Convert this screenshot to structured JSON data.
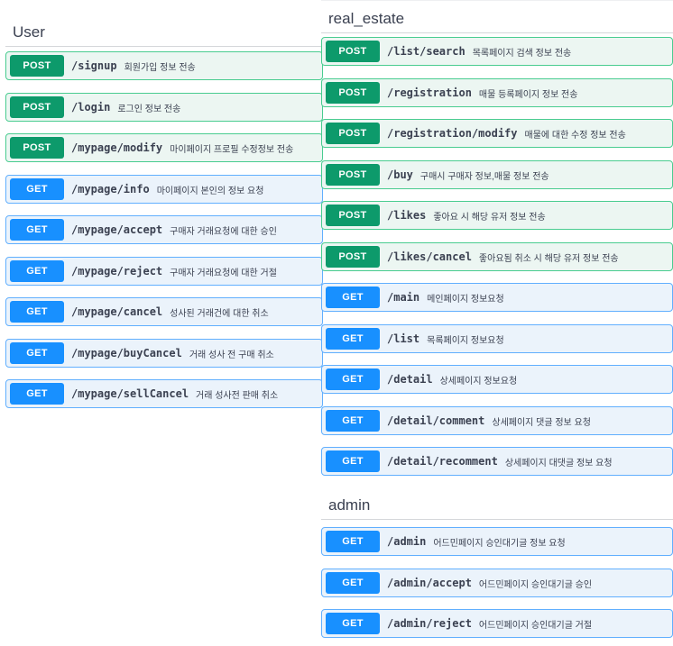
{
  "sections": {
    "user": {
      "title": "User",
      "ops": [
        {
          "method": "POST",
          "path": "/signup",
          "desc": "회원가입 정보 전송"
        },
        {
          "method": "POST",
          "path": "/login",
          "desc": "로그인 정보 전송"
        },
        {
          "method": "POST",
          "path": "/mypage/modify",
          "desc": "마이페이지 프로필 수정정보 전송"
        },
        {
          "method": "GET",
          "path": "/mypage/info",
          "desc": "마이페이지 본인의 정보 요청"
        },
        {
          "method": "GET",
          "path": "/mypage/accept",
          "desc": "구매자 거래요청에 대한 승인"
        },
        {
          "method": "GET",
          "path": "/mypage/reject",
          "desc": "구매자 거래요청에 대한 거절"
        },
        {
          "method": "GET",
          "path": "/mypage/cancel",
          "desc": "성사된 거래건에 대한 취소"
        },
        {
          "method": "GET",
          "path": "/mypage/buyCancel",
          "desc": "거래 성사 전 구매 취소"
        },
        {
          "method": "GET",
          "path": "/mypage/sellCancel",
          "desc": "거래 성사전 판매 취소"
        }
      ]
    },
    "real_estate": {
      "title": "real_estate",
      "ops": [
        {
          "method": "POST",
          "path": "/list/search",
          "desc": "목록페이지 검색 정보 전송"
        },
        {
          "method": "POST",
          "path": "/registration",
          "desc": "매물 등록페이지 정보 전송"
        },
        {
          "method": "POST",
          "path": "/registration/modify",
          "desc": "매물에 대한 수정 정보 전송"
        },
        {
          "method": "POST",
          "path": "/buy",
          "desc": "구매시 구매자 정보,매물 정보 전송"
        },
        {
          "method": "POST",
          "path": "/likes",
          "desc": "좋아요 시 해당 유저 정보 전송"
        },
        {
          "method": "POST",
          "path": "/likes/cancel",
          "desc": "좋아요됨 취소 시 해당 유저 정보 전송"
        },
        {
          "method": "GET",
          "path": "/main",
          "desc": "메인페이지 정보요청"
        },
        {
          "method": "GET",
          "path": "/list",
          "desc": "목록페이지 정보요청"
        },
        {
          "method": "GET",
          "path": "/detail",
          "desc": "상세페이지 정보요청"
        },
        {
          "method": "GET",
          "path": "/detail/comment",
          "desc": "상세페이지 댓글 정보 요청"
        },
        {
          "method": "GET",
          "path": "/detail/recomment",
          "desc": "상세페이지 대댓글 정보 요청"
        }
      ]
    },
    "admin": {
      "title": "admin",
      "ops": [
        {
          "method": "GET",
          "path": "/admin",
          "desc": "어드민페이지 승인대기글 정보 요청"
        },
        {
          "method": "GET",
          "path": "/admin/accept",
          "desc": "어드민페이지 승인대기글 승인"
        },
        {
          "method": "GET",
          "path": "/admin/reject",
          "desc": "어드민페이지 승인대기글 거절"
        }
      ]
    }
  },
  "colors": {
    "post_badge": "#0d9a6b",
    "get_badge": "#1890ff",
    "post_bg": "#ecf6f2",
    "get_bg": "#ebf3fb",
    "text": "#3b4151"
  }
}
